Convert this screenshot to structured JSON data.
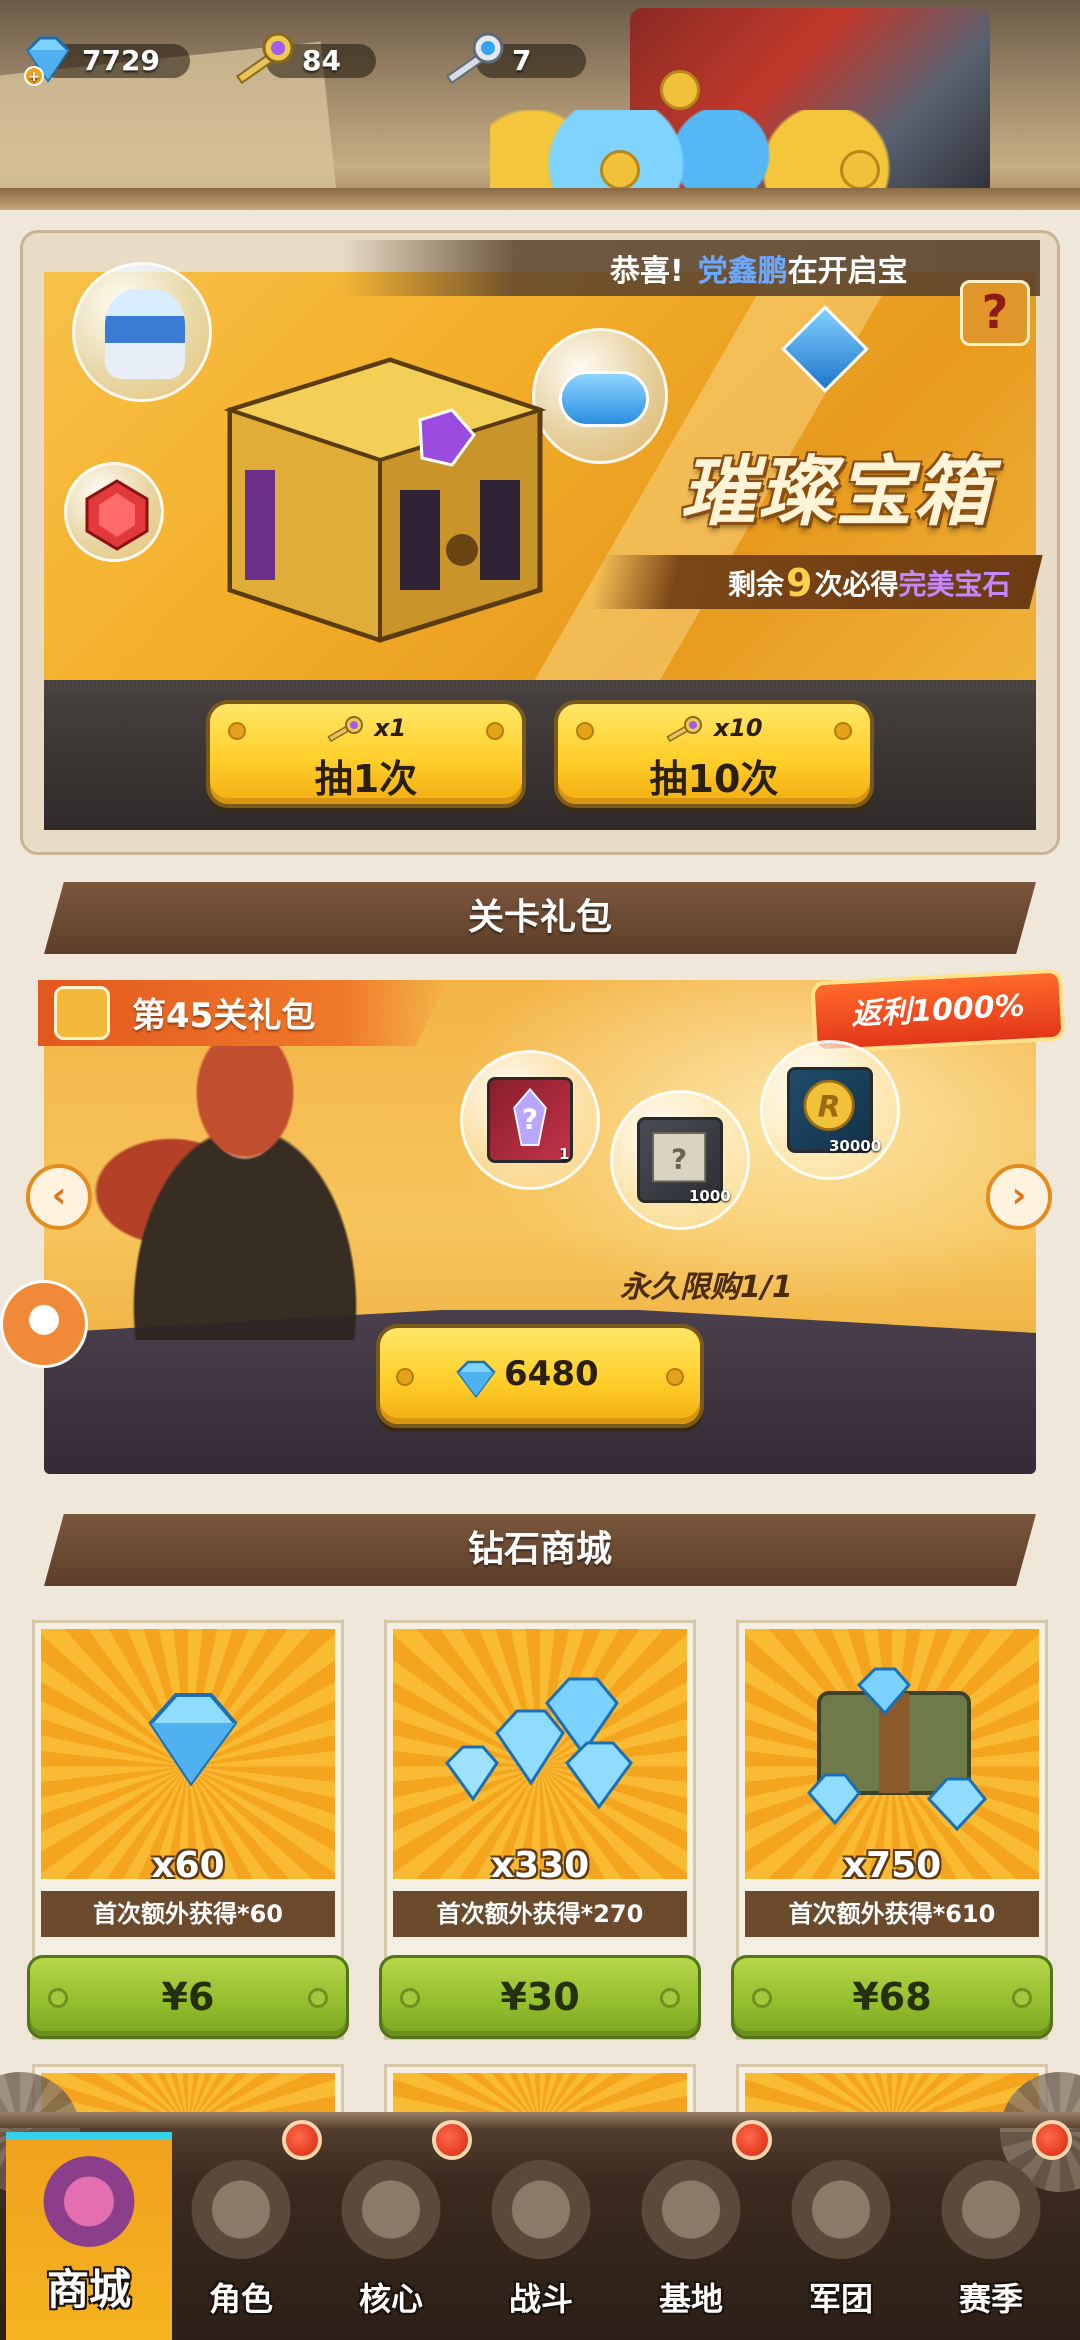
{
  "resources": [
    {
      "icon": "gem-icon",
      "value": "7729"
    },
    {
      "icon": "purple-key-icon",
      "value": "84"
    },
    {
      "icon": "blue-key-icon",
      "value": "7"
    }
  ],
  "chest": {
    "ticker_prefix": "恭喜!",
    "ticker_name": "党鑫鹏",
    "ticker_suffix": "在开启宝",
    "title": "璀璨宝箱",
    "remain_prefix": "剩余",
    "remain_count": "9",
    "remain_mid": "次必得",
    "remain_reward": "完美宝石",
    "help": "?",
    "draw1": {
      "cost": "x1",
      "label": "抽1次"
    },
    "draw10": {
      "cost": "x10",
      "label": "抽10次"
    }
  },
  "level_gift": {
    "section_title": "关卡礼包",
    "title": "第45关礼包",
    "rebate": "返利1000%",
    "items": [
      {
        "icon": "crystal-mystery-icon",
        "qty": "1"
      },
      {
        "icon": "scroll-mystery-icon",
        "qty": "1000"
      },
      {
        "icon": "gold-coin-r-icon",
        "qty": "30000"
      }
    ],
    "limit": "永久限购1/1",
    "price": "6480",
    "prev": "‹",
    "next": "›"
  },
  "diamond_shop": {
    "section_title": "钻石商城",
    "packs": [
      {
        "amount": "x60",
        "bonus": "首次额外获得*60",
        "price": "¥6"
      },
      {
        "amount": "x330",
        "bonus": "首次额外获得*270",
        "price": "¥30"
      },
      {
        "amount": "x750",
        "bonus": "首次额外获得*610",
        "price": "¥68"
      }
    ]
  },
  "nav": [
    {
      "label": "商城",
      "active": true
    },
    {
      "label": "角色"
    },
    {
      "label": "核心"
    },
    {
      "label": "战斗"
    },
    {
      "label": "基地"
    },
    {
      "label": "军团"
    },
    {
      "label": "赛季"
    }
  ],
  "colors": {
    "accent_yellow": "#ffcf2b",
    "header_brown": "#6b4a2e",
    "buy_green": "#93bd2d",
    "ticker_blue": "#6ba8ff",
    "reward_purple": "#c388ff"
  }
}
